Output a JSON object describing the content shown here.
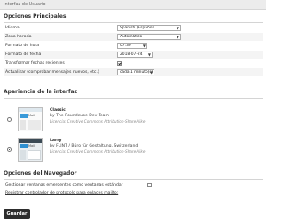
{
  "header": {
    "title": "Interfaz de Usuario"
  },
  "sections": {
    "main": {
      "title": "Opciones Principales",
      "rows": [
        {
          "label": "Idioma",
          "value": "Spanish (Español)"
        },
        {
          "label": "Zona horaria",
          "value": "Automático"
        },
        {
          "label": "Formato de hora",
          "value": "07:30"
        },
        {
          "label": "Formato de fecha",
          "value": "2018-07-24"
        },
        {
          "label": "Transformar fechas recientes",
          "checked": true
        },
        {
          "label": "Actualizar (comprobar mensajes nuevos, etc.)",
          "value": "cada 1 minuto(s)"
        }
      ]
    },
    "appearance": {
      "title": "Apariencia de la interfaz",
      "skins": [
        {
          "name": "Classic",
          "author": "by The Roundcube Dev Team",
          "license": "Licencia: Creative Commons Attribution-ShareAlike",
          "thumb_text": "Mail",
          "selected": false
        },
        {
          "name": "Larry",
          "author": "by FLINT / Büro für Gestaltung, Switzerland",
          "license": "Licencia: Creative Commons Attribution-ShareAlike",
          "thumb_text": "Mail",
          "selected": true
        }
      ]
    },
    "browser": {
      "title": "Opciones del Navegador",
      "popup_label": "Gestionar ventanas emergentes como ventanas estándar",
      "popup_checked": false,
      "protocol_link": "Registrar controlador de protocolo para enlaces mailto:"
    }
  },
  "footer": {
    "save_label": "Guardar"
  }
}
